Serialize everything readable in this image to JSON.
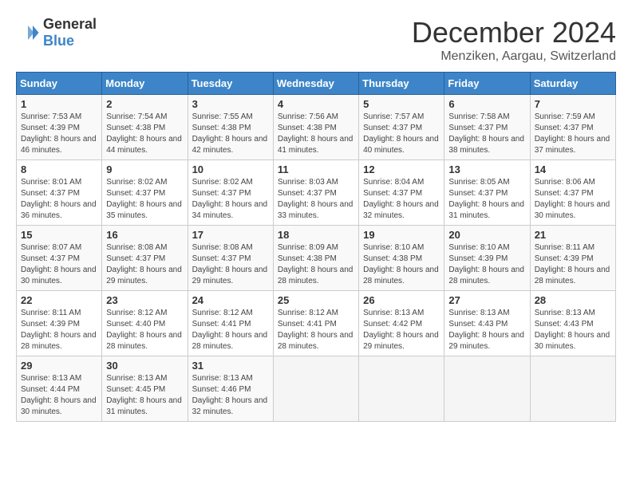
{
  "header": {
    "logo_general": "General",
    "logo_blue": "Blue",
    "title": "December 2024",
    "location": "Menziken, Aargau, Switzerland"
  },
  "weekdays": [
    "Sunday",
    "Monday",
    "Tuesday",
    "Wednesday",
    "Thursday",
    "Friday",
    "Saturday"
  ],
  "weeks": [
    [
      {
        "day": "1",
        "sunrise": "7:53 AM",
        "sunset": "4:39 PM",
        "daylight": "8 hours and 46 minutes."
      },
      {
        "day": "2",
        "sunrise": "7:54 AM",
        "sunset": "4:38 PM",
        "daylight": "8 hours and 44 minutes."
      },
      {
        "day": "3",
        "sunrise": "7:55 AM",
        "sunset": "4:38 PM",
        "daylight": "8 hours and 42 minutes."
      },
      {
        "day": "4",
        "sunrise": "7:56 AM",
        "sunset": "4:38 PM",
        "daylight": "8 hours and 41 minutes."
      },
      {
        "day": "5",
        "sunrise": "7:57 AM",
        "sunset": "4:37 PM",
        "daylight": "8 hours and 40 minutes."
      },
      {
        "day": "6",
        "sunrise": "7:58 AM",
        "sunset": "4:37 PM",
        "daylight": "8 hours and 38 minutes."
      },
      {
        "day": "7",
        "sunrise": "7:59 AM",
        "sunset": "4:37 PM",
        "daylight": "8 hours and 37 minutes."
      }
    ],
    [
      {
        "day": "8",
        "sunrise": "8:01 AM",
        "sunset": "4:37 PM",
        "daylight": "8 hours and 36 minutes."
      },
      {
        "day": "9",
        "sunrise": "8:02 AM",
        "sunset": "4:37 PM",
        "daylight": "8 hours and 35 minutes."
      },
      {
        "day": "10",
        "sunrise": "8:02 AM",
        "sunset": "4:37 PM",
        "daylight": "8 hours and 34 minutes."
      },
      {
        "day": "11",
        "sunrise": "8:03 AM",
        "sunset": "4:37 PM",
        "daylight": "8 hours and 33 minutes."
      },
      {
        "day": "12",
        "sunrise": "8:04 AM",
        "sunset": "4:37 PM",
        "daylight": "8 hours and 32 minutes."
      },
      {
        "day": "13",
        "sunrise": "8:05 AM",
        "sunset": "4:37 PM",
        "daylight": "8 hours and 31 minutes."
      },
      {
        "day": "14",
        "sunrise": "8:06 AM",
        "sunset": "4:37 PM",
        "daylight": "8 hours and 30 minutes."
      }
    ],
    [
      {
        "day": "15",
        "sunrise": "8:07 AM",
        "sunset": "4:37 PM",
        "daylight": "8 hours and 30 minutes."
      },
      {
        "day": "16",
        "sunrise": "8:08 AM",
        "sunset": "4:37 PM",
        "daylight": "8 hours and 29 minutes."
      },
      {
        "day": "17",
        "sunrise": "8:08 AM",
        "sunset": "4:37 PM",
        "daylight": "8 hours and 29 minutes."
      },
      {
        "day": "18",
        "sunrise": "8:09 AM",
        "sunset": "4:38 PM",
        "daylight": "8 hours and 28 minutes."
      },
      {
        "day": "19",
        "sunrise": "8:10 AM",
        "sunset": "4:38 PM",
        "daylight": "8 hours and 28 minutes."
      },
      {
        "day": "20",
        "sunrise": "8:10 AM",
        "sunset": "4:39 PM",
        "daylight": "8 hours and 28 minutes."
      },
      {
        "day": "21",
        "sunrise": "8:11 AM",
        "sunset": "4:39 PM",
        "daylight": "8 hours and 28 minutes."
      }
    ],
    [
      {
        "day": "22",
        "sunrise": "8:11 AM",
        "sunset": "4:39 PM",
        "daylight": "8 hours and 28 minutes."
      },
      {
        "day": "23",
        "sunrise": "8:12 AM",
        "sunset": "4:40 PM",
        "daylight": "8 hours and 28 minutes."
      },
      {
        "day": "24",
        "sunrise": "8:12 AM",
        "sunset": "4:41 PM",
        "daylight": "8 hours and 28 minutes."
      },
      {
        "day": "25",
        "sunrise": "8:12 AM",
        "sunset": "4:41 PM",
        "daylight": "8 hours and 28 minutes."
      },
      {
        "day": "26",
        "sunrise": "8:13 AM",
        "sunset": "4:42 PM",
        "daylight": "8 hours and 29 minutes."
      },
      {
        "day": "27",
        "sunrise": "8:13 AM",
        "sunset": "4:43 PM",
        "daylight": "8 hours and 29 minutes."
      },
      {
        "day": "28",
        "sunrise": "8:13 AM",
        "sunset": "4:43 PM",
        "daylight": "8 hours and 30 minutes."
      }
    ],
    [
      {
        "day": "29",
        "sunrise": "8:13 AM",
        "sunset": "4:44 PM",
        "daylight": "8 hours and 30 minutes."
      },
      {
        "day": "30",
        "sunrise": "8:13 AM",
        "sunset": "4:45 PM",
        "daylight": "8 hours and 31 minutes."
      },
      {
        "day": "31",
        "sunrise": "8:13 AM",
        "sunset": "4:46 PM",
        "daylight": "8 hours and 32 minutes."
      },
      null,
      null,
      null,
      null
    ]
  ]
}
